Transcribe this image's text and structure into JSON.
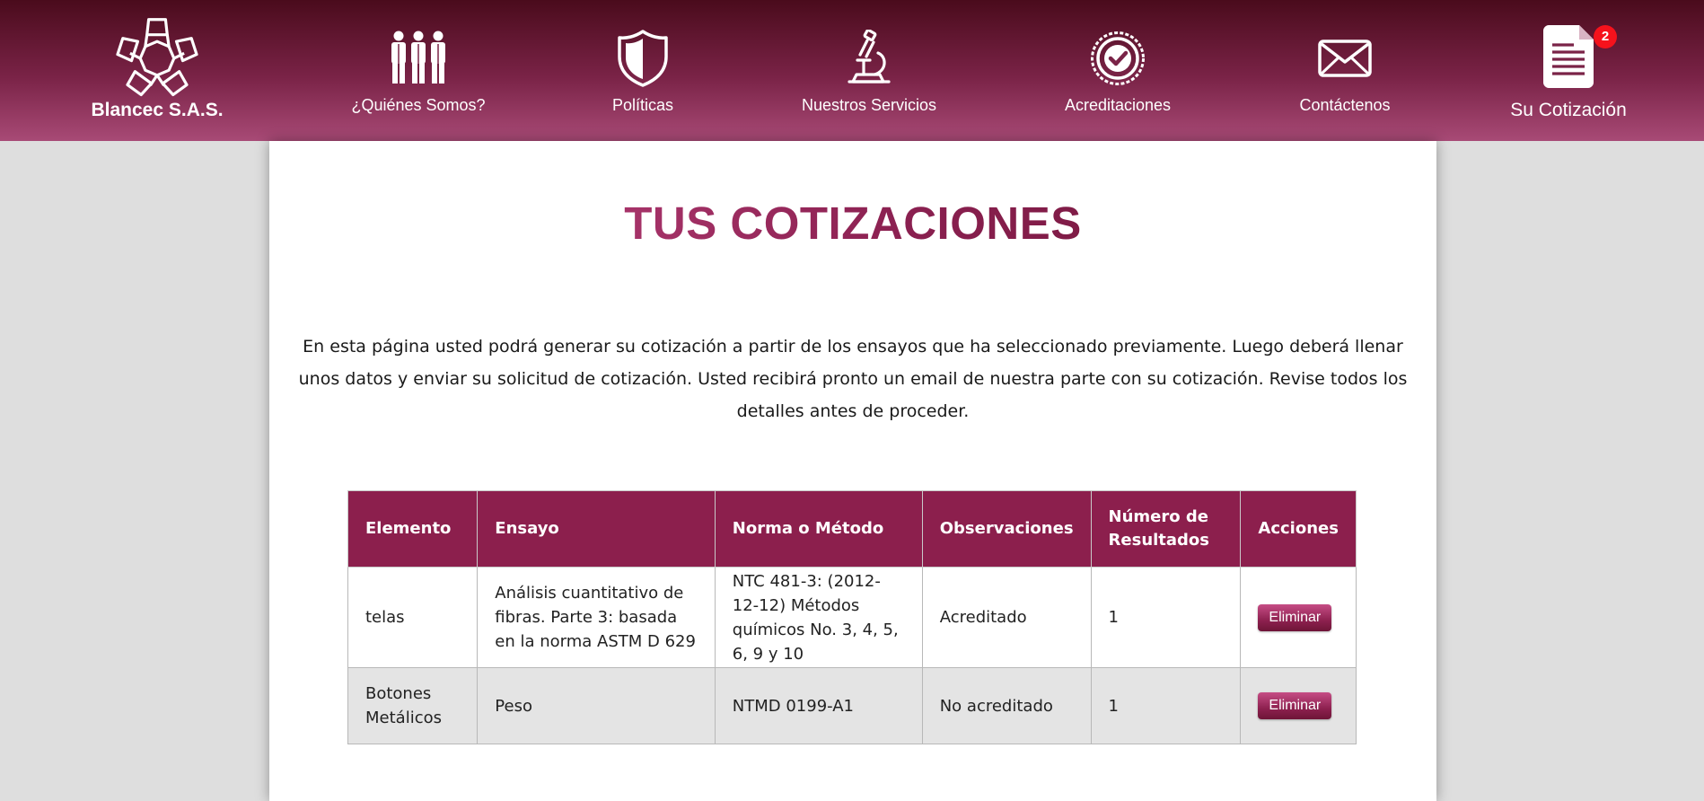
{
  "header": {
    "logo_label": "Blancec S.A.S.",
    "nav": [
      {
        "label": "¿Quiénes Somos?",
        "icon": "people-icon"
      },
      {
        "label": "Políticas",
        "icon": "shield-icon"
      },
      {
        "label": "Nuestros Servicios",
        "icon": "microscope-icon"
      },
      {
        "label": "Acreditaciones",
        "icon": "check-seal-icon"
      },
      {
        "label": "Contáctenos",
        "icon": "envelope-icon"
      }
    ],
    "quote": {
      "label": "Su Cotización",
      "icon": "document-icon",
      "badge_count": "2"
    }
  },
  "main": {
    "title": "TUS COTIZACIONES",
    "intro": "En esta página usted podrá generar su cotización a partir de los ensayos que ha seleccionado previamente. Luego deberá llenar unos datos y enviar su solicitud de cotización. Usted recibirá pronto un email de nuestra parte con su cotización. Revise todos los detalles antes de proceder."
  },
  "table": {
    "headers": [
      "Elemento",
      "Ensayo",
      "Norma o Método",
      "Observaciones",
      "Número de Resultados",
      "Acciones"
    ],
    "rows": [
      {
        "elemento": "telas",
        "ensayo": "Análisis cuantitativo de fibras. Parte 3: basada en la norma ASTM D 629",
        "norma": "NTC 481-3: (2012-12-12) Métodos químicos No. 3, 4, 5, 6, 9 y 10",
        "observaciones": "Acreditado",
        "resultados": "1",
        "accion": "Eliminar"
      },
      {
        "elemento": "Botones Metálicos",
        "ensayo": "Peso",
        "norma": "NTMD 0199-A1",
        "observaciones": "No acreditado",
        "resultados": "1",
        "accion": "Eliminar"
      }
    ]
  },
  "colors": {
    "header_dark": "#4a0b1c",
    "header_light": "#a84a76",
    "accent": "#8c1f4d",
    "badge": "#f5121c",
    "page_bg": "#dedede"
  }
}
